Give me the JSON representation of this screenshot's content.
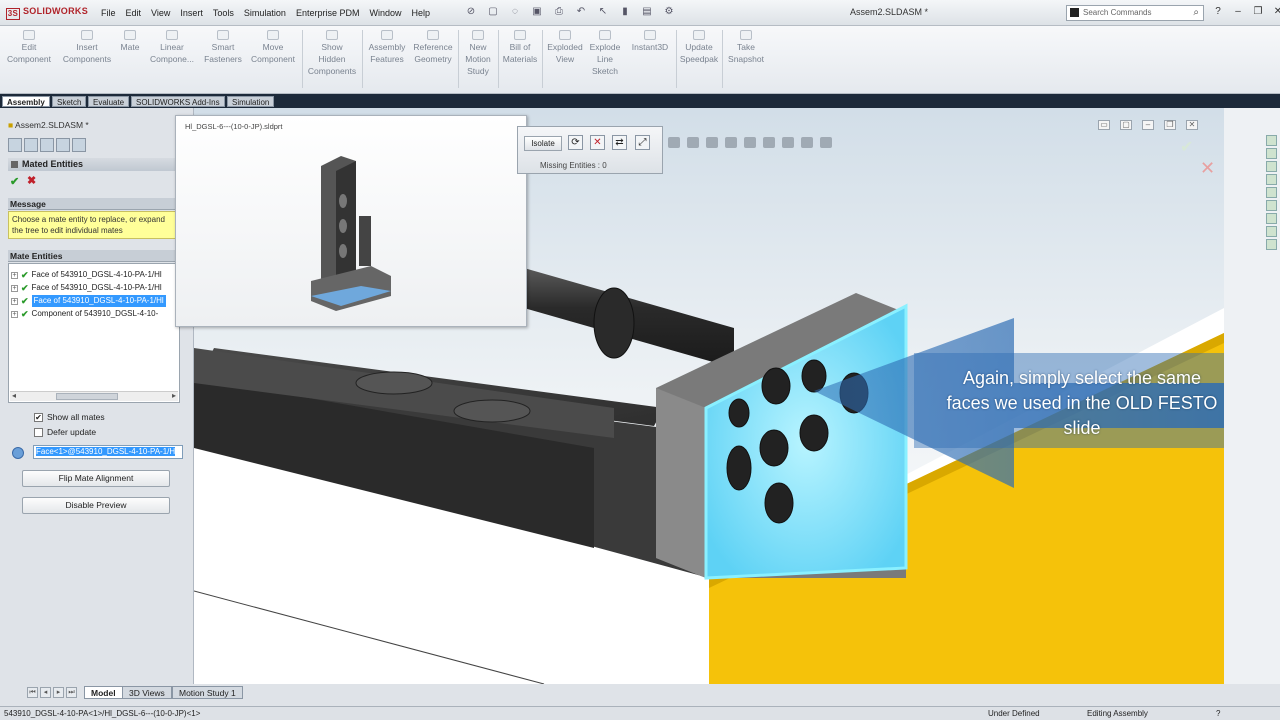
{
  "titlebar": {
    "logo": "SOLIDWORKS",
    "menu": [
      "File",
      "Edit",
      "View",
      "Insert",
      "Tools",
      "Simulation",
      "Enterprise PDM",
      "Window",
      "Help"
    ],
    "doc_title": "Assem2.SLDASM *",
    "search_placeholder": "Search Commands"
  },
  "ribbon": {
    "buttons": [
      "Edit\nComponent",
      "Insert\nComponents",
      "Mate",
      "Linear\nCompone...",
      "Smart\nFasteners",
      "Move\nComponent",
      "Show\nHidden\nComponents",
      "Assembly\nFeatures",
      "Reference\nGeometry",
      "New\nMotion\nStudy",
      "Bill of\nMaterials",
      "Exploded\nView",
      "Explode\nLine\nSketch",
      "Instant3D",
      "Update\nSpeedpak",
      "Take\nSnapshot"
    ]
  },
  "cmd_tabs": [
    "Assembly",
    "Sketch",
    "Evaluate",
    "SOLIDWORKS Add-Ins",
    "Simulation"
  ],
  "left_panel": {
    "tree_title": "Assem2.SLDASM *",
    "mated_header": "Mated Entities",
    "message_header": "Message",
    "message_line1": "Choose a mate entity to replace, or expand",
    "message_line2": "the tree to edit individual mates",
    "mate_entities_header": "Mate Entities",
    "mate_items": [
      "Face of 543910_DGSL-4-10-PA-1/Hl",
      "Face of 543910_DGSL-4-10-PA-1/Hl",
      "Face of 543910_DGSL-4-10-PA-1/Hl",
      "Component of 543910_DGSL-4-10-"
    ],
    "show_all_mates": "Show all mates",
    "defer_update": "Defer update",
    "selection_value": "Face<1>@543910_DGSL-4-10-PA-1/H",
    "flip_button": "Flip Mate Alignment",
    "disable_button": "Disable Preview"
  },
  "preview": {
    "title": "Hl_DGSL-6---(10-0-JP).sldprt"
  },
  "isolate_bar": {
    "isolate_label": "Isolate",
    "missing_label": "Missing Entities :",
    "missing_count": "0"
  },
  "callout": {
    "line1": "Again, simply select the same",
    "line2": "faces we used in the OLD FESTO",
    "line3": "slide"
  },
  "bottom_tabs": [
    "Model",
    "3D Views",
    "Motion Study 1"
  ],
  "statusbar": {
    "left": "543910_DGSL-4-10-PA<1>/Hl_DGSL-6---(10-0-JP)<1>",
    "definition": "Under Defined",
    "mode": "Editing Assembly",
    "help": "?"
  },
  "colors": {
    "highlight_face": "#7fe3ff",
    "base_yellow": "#f5c20a",
    "callout_blue": "#2e6db4",
    "selection_blue": "#3399ff"
  }
}
